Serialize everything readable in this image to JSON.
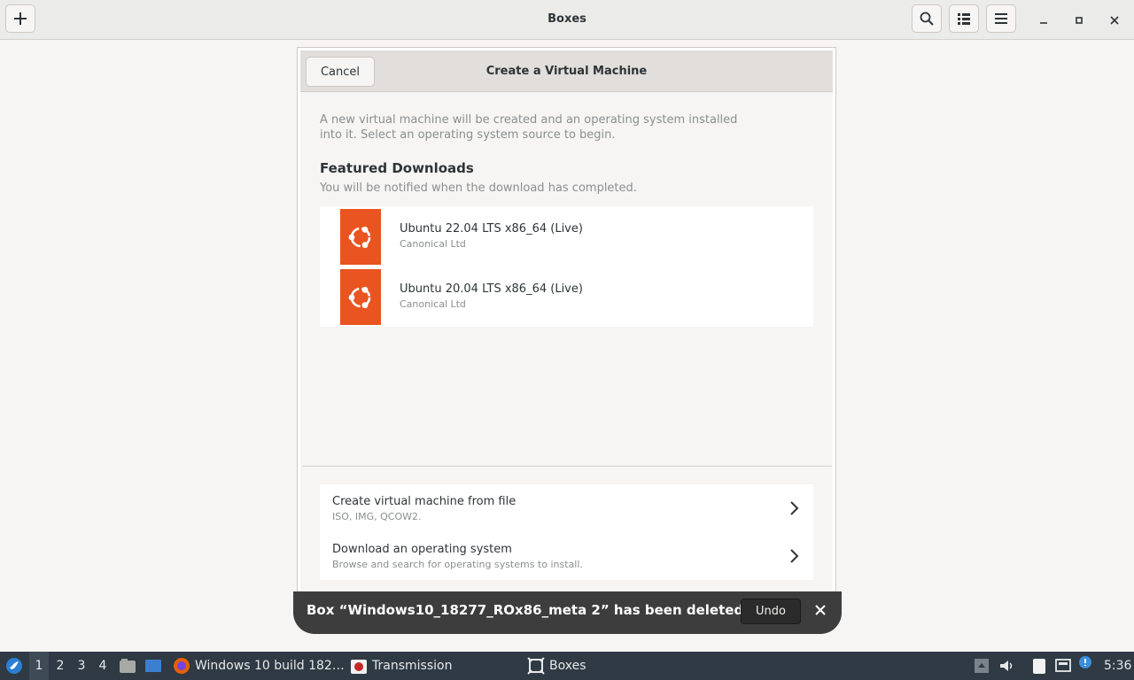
{
  "header": {
    "title": "Boxes",
    "new_icon": "plus-icon",
    "search_icon": "search-icon",
    "view_icon": "list-view-icon",
    "menu_icon": "hamburger-menu-icon"
  },
  "dialog": {
    "cancel_label": "Cancel",
    "title": "Create a Virtual Machine",
    "intro_line1": "A new virtual machine will be created and an operating system installed",
    "intro_line2": "into it. Select an operating system source to begin.",
    "featured_heading": "Featured Downloads",
    "featured_sub": "You will be notified when the download has completed.",
    "os_items": [
      {
        "name": "Ubuntu 22.04 LTS x86_64 (Live)",
        "vendor": "Canonical Ltd",
        "icon": "ubuntu-logo-icon"
      },
      {
        "name": "Ubuntu 20.04 LTS x86_64 (Live)",
        "vendor": "Canonical Ltd",
        "icon": "ubuntu-logo-icon"
      }
    ],
    "actions": [
      {
        "title": "Create virtual machine from file",
        "subtitle": "ISO, IMG, QCOW2."
      },
      {
        "title": "Download an operating system",
        "subtitle": "Browse and search for operating systems to install."
      }
    ]
  },
  "toast": {
    "message": "Box “Windows10_18277_ROx86_meta 2” has been deleted",
    "undo_label": "Undo"
  },
  "taskbar": {
    "workspaces": [
      "1",
      "2",
      "3",
      "4"
    ],
    "apps": [
      {
        "label": "Windows 10 build 182…",
        "icon": "firefox-icon"
      },
      {
        "label": "Transmission",
        "icon": "transmission-icon"
      },
      {
        "label": "Boxes",
        "icon": "boxes-icon"
      }
    ],
    "clock": "5:36"
  },
  "colors": {
    "ubuntu_orange": "#e95420",
    "taskbar_bg": "#2f3a44",
    "toast_bg": "#3d3d3d"
  }
}
